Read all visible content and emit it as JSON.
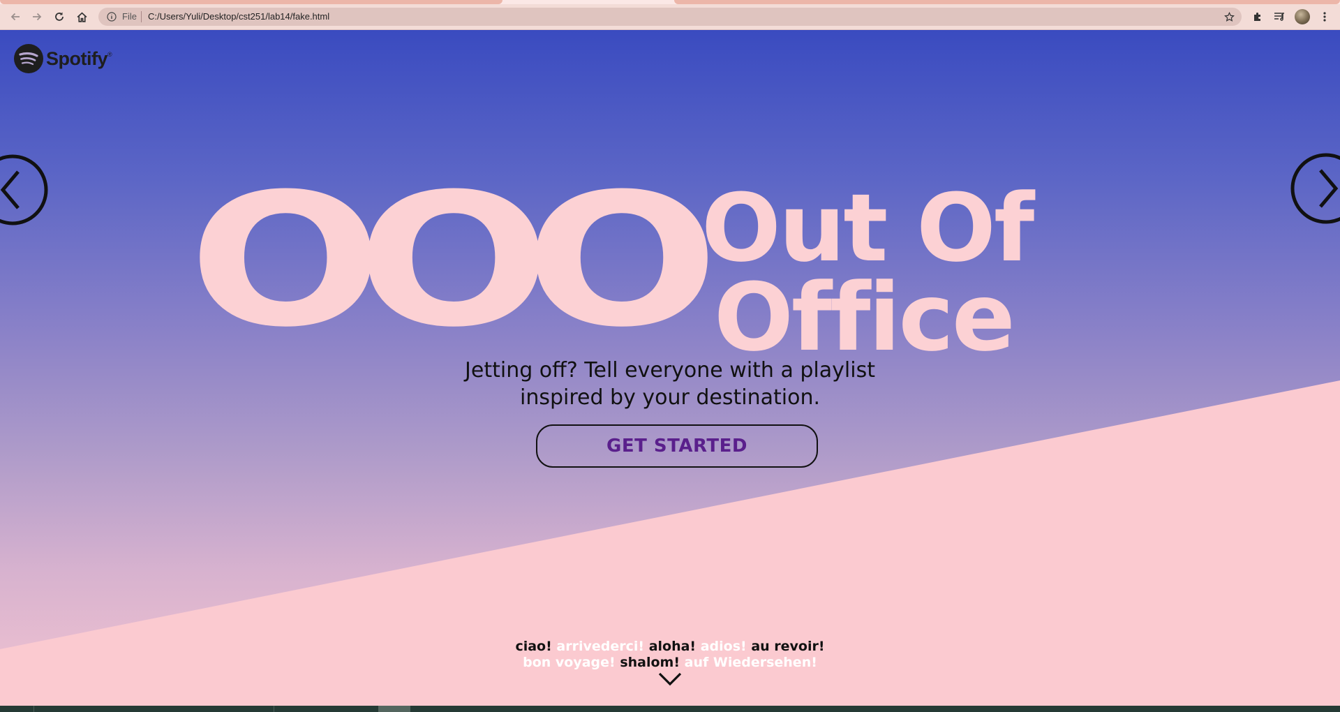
{
  "browser": {
    "address_scheme": "File",
    "address_url": "C:/Users/Yuli/Desktop/cst251/lab14/fake.html"
  },
  "page": {
    "logo_text": "Spotify",
    "logo_tm": "®",
    "hero_ooo": "OOO",
    "hero_title_line1": "Out Of",
    "hero_title_line2": "Office",
    "subtitle_line1": "Jetting off? Tell everyone with a playlist",
    "subtitle_line2": "inspired by your destination.",
    "cta_label": "GET STARTED",
    "greetings": {
      "row1": [
        {
          "text": "ciao!",
          "tone": "dark"
        },
        {
          "text": "arrivederci!",
          "tone": "light"
        },
        {
          "text": "aloha!",
          "tone": "dark"
        },
        {
          "text": "adios!",
          "tone": "light"
        },
        {
          "text": "au revoir!",
          "tone": "dark"
        }
      ],
      "row2": [
        {
          "text": "bon voyage!",
          "tone": "light"
        },
        {
          "text": "shalom!",
          "tone": "dark"
        },
        {
          "text": "auf Wiedersehen!",
          "tone": "light"
        }
      ]
    }
  },
  "colors": {
    "gradient_top": "#3a4bc0",
    "gradient_bottom": "#f3c4d0",
    "pink_wedge": "#fbcad0",
    "hero_text": "#fcd1d4",
    "cta_text": "#5a1f8c"
  },
  "icons": {
    "back": "arrow-left-icon",
    "forward": "arrow-right-icon",
    "reload": "reload-icon",
    "home": "home-icon",
    "site_info": "info-icon",
    "bookmark": "star-icon",
    "extensions": "puzzle-icon",
    "media": "media-queue-icon",
    "menu": "kebab-menu-icon",
    "carousel_prev": "chevron-left-circle-icon",
    "carousel_next": "chevron-right-circle-icon",
    "scroll_down": "chevron-down-icon"
  }
}
